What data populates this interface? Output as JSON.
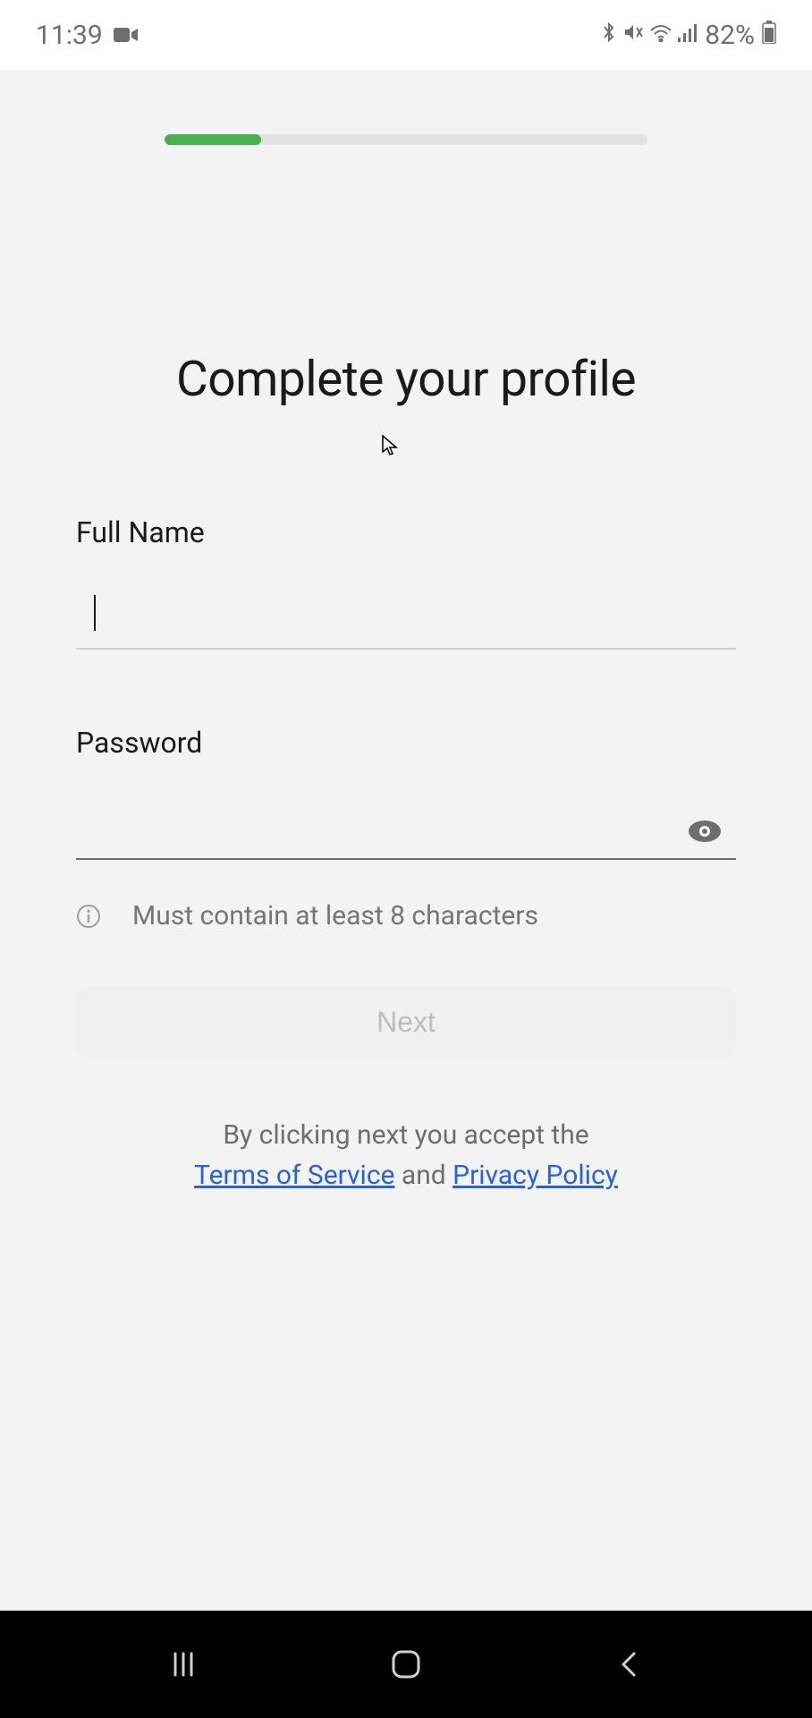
{
  "statusBar": {
    "time": "11:39",
    "batteryPercent": "82%"
  },
  "progress": {
    "percent": 20
  },
  "page": {
    "title": "Complete your profile"
  },
  "form": {
    "fullName": {
      "label": "Full Name",
      "value": ""
    },
    "password": {
      "label": "Password",
      "value": "",
      "hint": "Must contain at least 8 characters"
    },
    "nextButton": "Next"
  },
  "legal": {
    "prefix": "By clicking next you accept the",
    "termsLink": "Terms of Service",
    "connector": " and ",
    "privacyLink": "Privacy Policy"
  }
}
